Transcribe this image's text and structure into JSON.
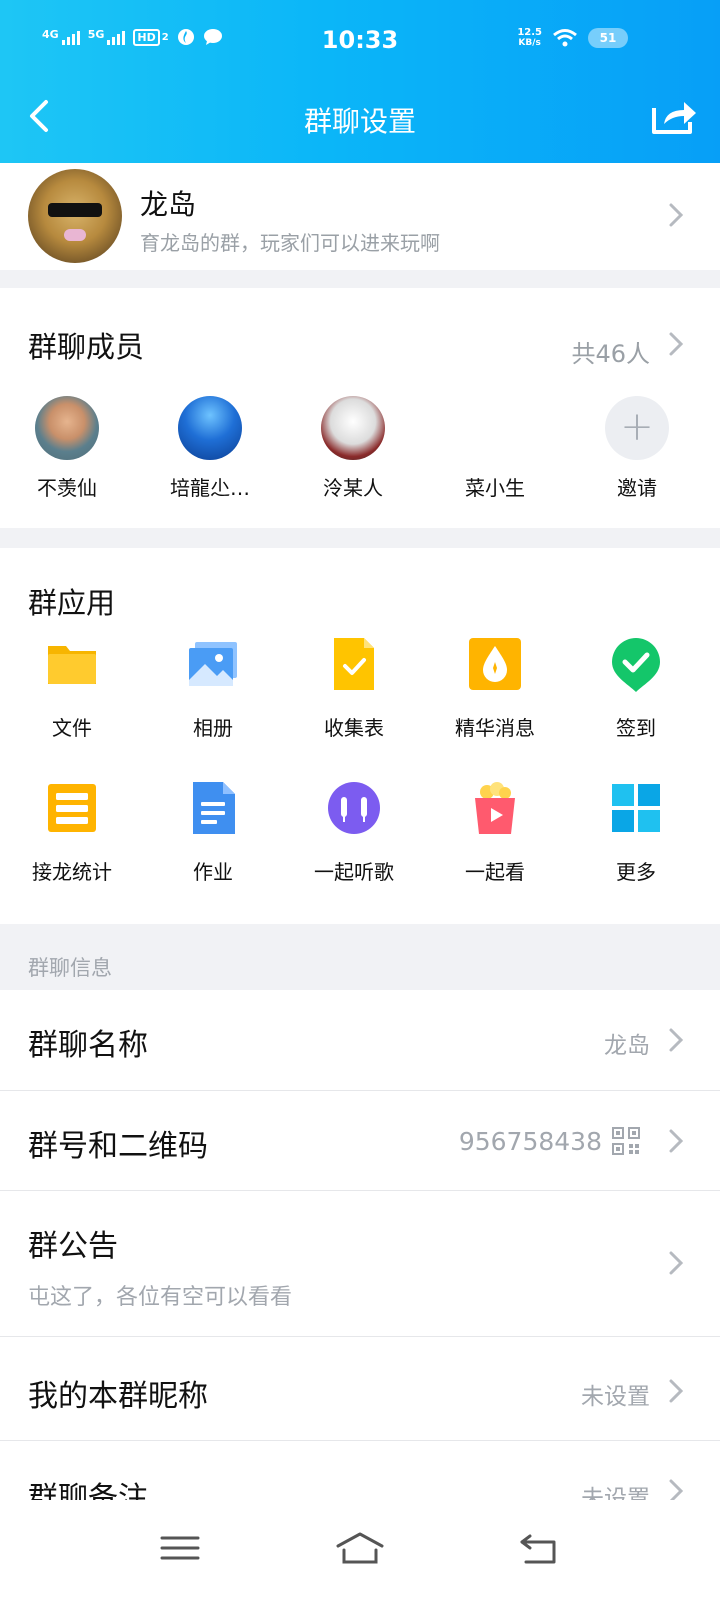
{
  "status": {
    "time": "10:33",
    "net1": "4G",
    "net2": "5G",
    "hd": "HD",
    "hd_sub": "2",
    "speed_value": "12.5",
    "speed_unit": "KB/s",
    "battery": "51"
  },
  "nav": {
    "title": "群聊设置"
  },
  "group": {
    "name": "龙岛",
    "description": "育龙岛的群，玩家们可以进来玩啊"
  },
  "members": {
    "title": "群聊成员",
    "count": "共46人",
    "list": [
      {
        "name": "不羡仙"
      },
      {
        "name": "培龍尐…"
      },
      {
        "name": "泠某人"
      },
      {
        "name": "菜小生"
      },
      {
        "name": "邀请"
      }
    ]
  },
  "apps": {
    "title": "群应用",
    "items": [
      {
        "label": "文件",
        "icon": "folder-icon"
      },
      {
        "label": "相册",
        "icon": "album-icon"
      },
      {
        "label": "收集表",
        "icon": "form-icon"
      },
      {
        "label": "精华消息",
        "icon": "essence-icon"
      },
      {
        "label": "签到",
        "icon": "checkin-icon"
      },
      {
        "label": "接龙统计",
        "icon": "relay-icon"
      },
      {
        "label": "作业",
        "icon": "homework-icon"
      },
      {
        "label": "一起听歌",
        "icon": "music-icon"
      },
      {
        "label": "一起看",
        "icon": "watch-icon"
      },
      {
        "label": "更多",
        "icon": "more-grid-icon"
      }
    ]
  },
  "info": {
    "section_label": "群聊信息",
    "name_row": {
      "title": "群聊名称",
      "value": "龙岛"
    },
    "number_row": {
      "title": "群号和二维码",
      "value": "956758438"
    },
    "notice_row": {
      "title": "群公告",
      "sub": "屯这了，各位有空可以看看"
    },
    "nickname_row": {
      "title": "我的本群昵称",
      "value": "未设置"
    },
    "remark_row": {
      "title": "群聊备注",
      "value": "未设置"
    }
  },
  "colors": {
    "header_start": "#1ec6f5",
    "header_end": "#079ff7",
    "accent": "#0bb6f8"
  }
}
